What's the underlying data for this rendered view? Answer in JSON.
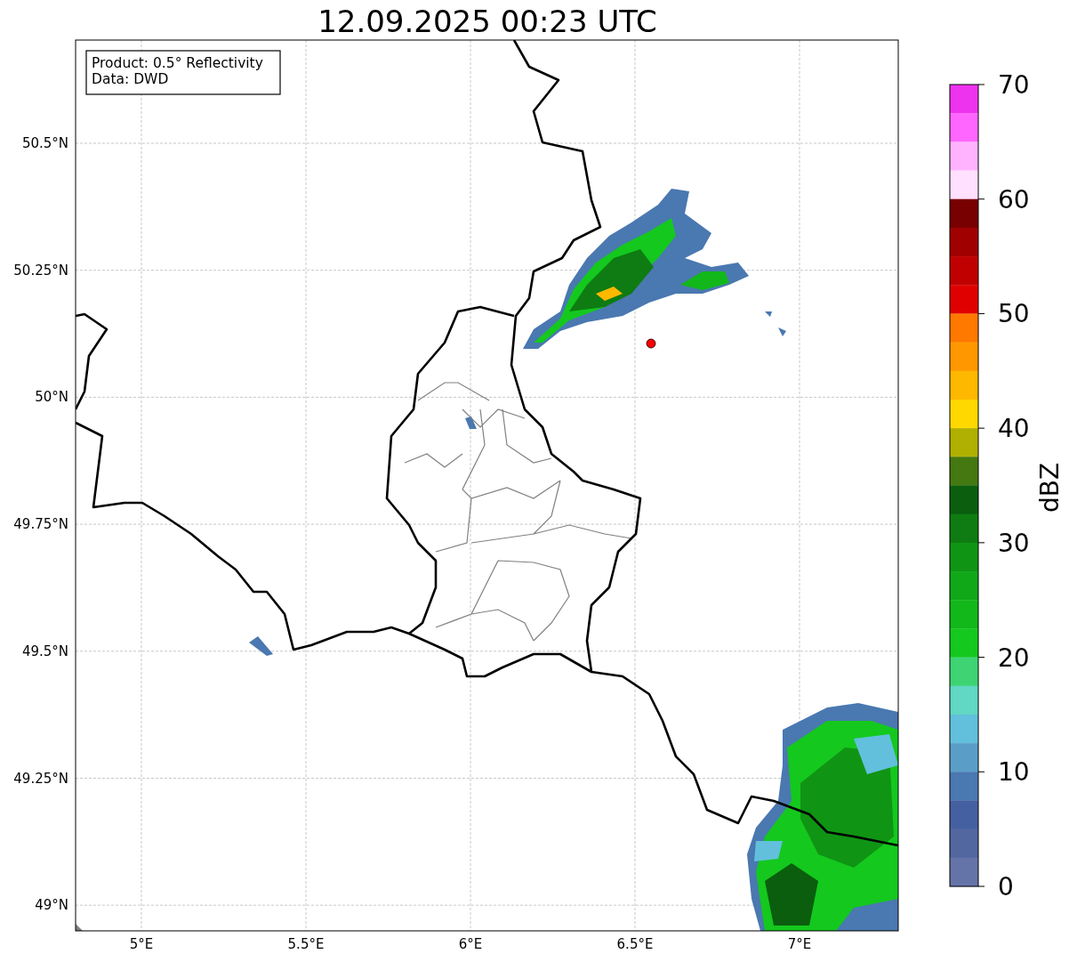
{
  "title": "12.09.2025 00:23 UTC",
  "legend": [
    "Product: 0.5° Reflectivity",
    "Data: DWD"
  ],
  "map": {
    "x_ticks": [
      "5°E",
      "5.5°E",
      "6°E",
      "6.5°E",
      "7°E"
    ],
    "y_ticks": [
      "50.5°N",
      "50.25°N",
      "50°N",
      "49.75°N",
      "49.5°N",
      "49.25°N",
      "49°N"
    ]
  },
  "colorbar": {
    "label": "dBZ",
    "ticks": [
      "70",
      "60",
      "50",
      "40",
      "30",
      "20",
      "10",
      "0"
    ],
    "segments": [
      {
        "color": "#ee33ee"
      },
      {
        "color": "#ff66ff"
      },
      {
        "color": "#ffb3ff"
      },
      {
        "color": "#ffe0ff"
      },
      {
        "color": "#780000"
      },
      {
        "color": "#a00000"
      },
      {
        "color": "#c00000"
      },
      {
        "color": "#e00000"
      },
      {
        "color": "#ff7800"
      },
      {
        "color": "#ff9800"
      },
      {
        "color": "#ffb800"
      },
      {
        "color": "#ffd800"
      },
      {
        "color": "#b0b000"
      },
      {
        "color": "#447810"
      },
      {
        "color": "#0a5e0e"
      },
      {
        "color": "#0e7c12"
      },
      {
        "color": "#109414"
      },
      {
        "color": "#10a818"
      },
      {
        "color": "#12b81a"
      },
      {
        "color": "#14c81e"
      },
      {
        "color": "#3ed474"
      },
      {
        "color": "#60d8c4"
      },
      {
        "color": "#62c0dc"
      },
      {
        "color": "#5a9ec8"
      },
      {
        "color": "#4a78b0"
      },
      {
        "color": "#4460a0"
      },
      {
        "color": "#5266a0"
      },
      {
        "color": "#6574a8"
      }
    ]
  }
}
